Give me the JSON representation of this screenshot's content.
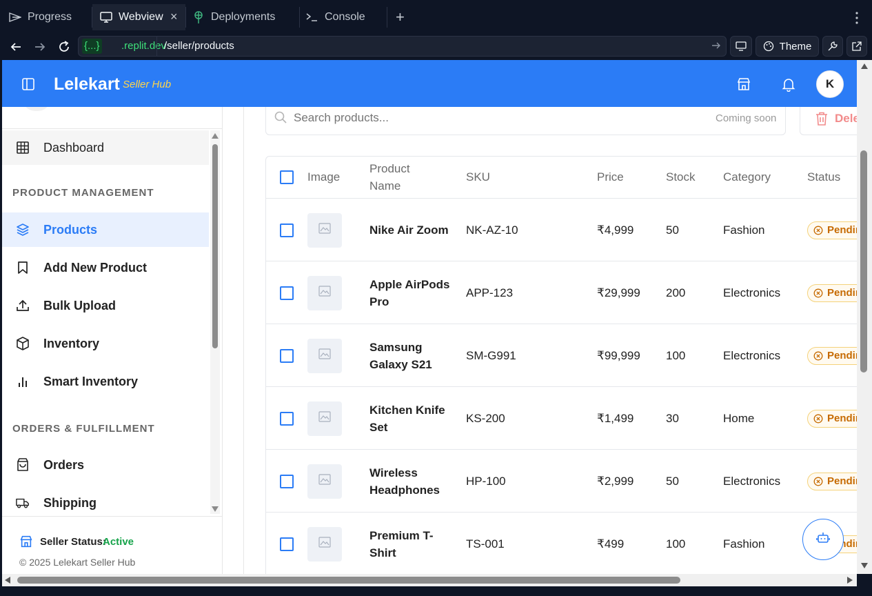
{
  "browser": {
    "tabs": [
      {
        "label": "Progress",
        "icon": "progress-icon"
      },
      {
        "label": "Webview",
        "icon": "monitor-icon"
      },
      {
        "label": "Deployments",
        "icon": "deployments-icon"
      },
      {
        "label": "Console",
        "icon": "terminal-icon"
      }
    ],
    "close_tab_label": "×",
    "new_tab_label": "+",
    "url_badge": "{...}",
    "url_domain": ".replit.dev",
    "url_path": "/seller/products",
    "theme_label": "Theme"
  },
  "header": {
    "brand": "Lelekart",
    "brand_sub": "Seller Hub",
    "avatar_initial": "K"
  },
  "sidebar": {
    "dashboard_label": "Dashboard",
    "section_product": "PRODUCT MANAGEMENT",
    "product_items": [
      {
        "label": "Products",
        "icon": "layers-icon",
        "active": true
      },
      {
        "label": "Add New Product",
        "icon": "bookmark-icon"
      },
      {
        "label": "Bulk Upload",
        "icon": "upload-icon"
      },
      {
        "label": "Inventory",
        "icon": "box-icon"
      },
      {
        "label": "Smart Inventory",
        "icon": "bar-chart-icon"
      }
    ],
    "section_orders": "ORDERS & FULFILLMENT",
    "order_items": [
      {
        "label": "Orders",
        "icon": "shopping-bag-icon"
      },
      {
        "label": "Shipping",
        "icon": "truck-icon"
      }
    ],
    "status_label": "Seller Status:",
    "status_value": "Active",
    "copyright": "© 2025 Lelekart Seller Hub"
  },
  "toolbar": {
    "search_placeholder": "Search products...",
    "search_hint": "Coming soon",
    "delete_label": "Delete"
  },
  "table": {
    "columns": [
      "Image",
      "Product Name",
      "SKU",
      "Price",
      "Stock",
      "Category",
      "Status"
    ],
    "rows": [
      {
        "name": "Nike Air Zoom",
        "sku": "NK-AZ-10",
        "price": "₹4,999",
        "stock": "50",
        "category": "Fashion",
        "status": "Pending"
      },
      {
        "name": "Apple AirPods Pro",
        "sku": "APP-123",
        "price": "₹29,999",
        "stock": "200",
        "category": "Electronics",
        "status": "Pending"
      },
      {
        "name": "Samsung Galaxy S21",
        "sku": "SM-G991",
        "price": "₹99,999",
        "stock": "100",
        "category": "Electronics",
        "status": "Pending"
      },
      {
        "name": "Kitchen Knife Set",
        "sku": "KS-200",
        "price": "₹1,499",
        "stock": "30",
        "category": "Home",
        "status": "Pending"
      },
      {
        "name": "Wireless Headphones",
        "sku": "HP-100",
        "price": "₹2,999",
        "stock": "50",
        "category": "Electronics",
        "status": "Pending"
      },
      {
        "name": "Premium T-Shirt",
        "sku": "TS-001",
        "price": "₹499",
        "stock": "100",
        "category": "Fashion",
        "status": "Pending"
      }
    ]
  },
  "colors": {
    "brand_blue": "#2b7cf6",
    "brand_yellow": "#ffd54a",
    "status_green": "#16a34a",
    "pending_orange": "#c66a00"
  }
}
